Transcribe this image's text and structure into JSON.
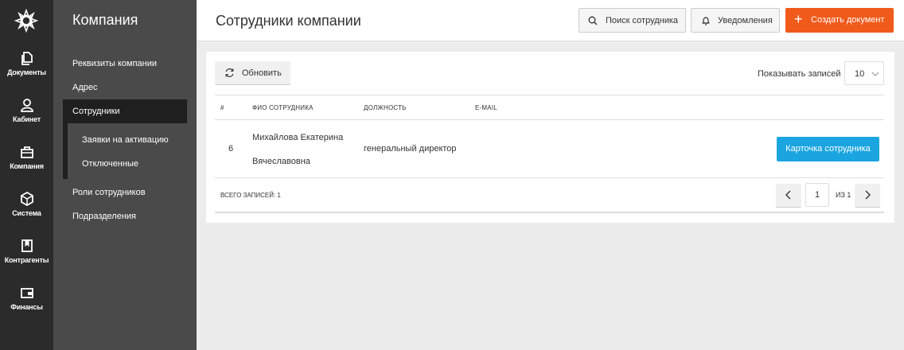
{
  "nav": {
    "items": [
      {
        "label": "Документы"
      },
      {
        "label": "Кабинет"
      },
      {
        "label": "Компания"
      },
      {
        "label": "Система"
      },
      {
        "label": "Контрагенты"
      },
      {
        "label": "Финансы"
      }
    ]
  },
  "sidebar": {
    "title": "Компания",
    "items": [
      {
        "label": "Реквизиты компании"
      },
      {
        "label": "Адрес"
      },
      {
        "label": "Сотрудники"
      },
      {
        "label": "Заявки на активацию"
      },
      {
        "label": "Отключенные"
      },
      {
        "label": "Роли сотрудников"
      },
      {
        "label": "Подразделения"
      }
    ]
  },
  "header": {
    "title": "Сотрудники компании",
    "search_label": "Поиск сотрудника",
    "notifications_label": "Уведомления",
    "create_label": "Создать документ"
  },
  "toolbar": {
    "refresh_label": "Обновить",
    "show_label": "Показывать записей",
    "page_size": "10"
  },
  "table": {
    "columns": [
      "#",
      "ФИО СОТРУДНИКА",
      "ДОЛЖНОСТЬ",
      "E-MAIL"
    ],
    "rows": [
      {
        "num": "6",
        "name_line1": "Михайлова  Екатерина",
        "name_line2": "Вячеславовна",
        "position": "генеральный директор",
        "email": "",
        "action": "Карточка сотрудника"
      }
    ]
  },
  "footer": {
    "total": "ВСЕГО ЗАПИСЕЙ: 1",
    "page": "1",
    "of": "ИЗ 1"
  },
  "colors": {
    "accent": "#f05a1a",
    "primary": "#1ba5e0",
    "rail": "#2b2b2b",
    "sidebar": "#4a4a4a"
  }
}
